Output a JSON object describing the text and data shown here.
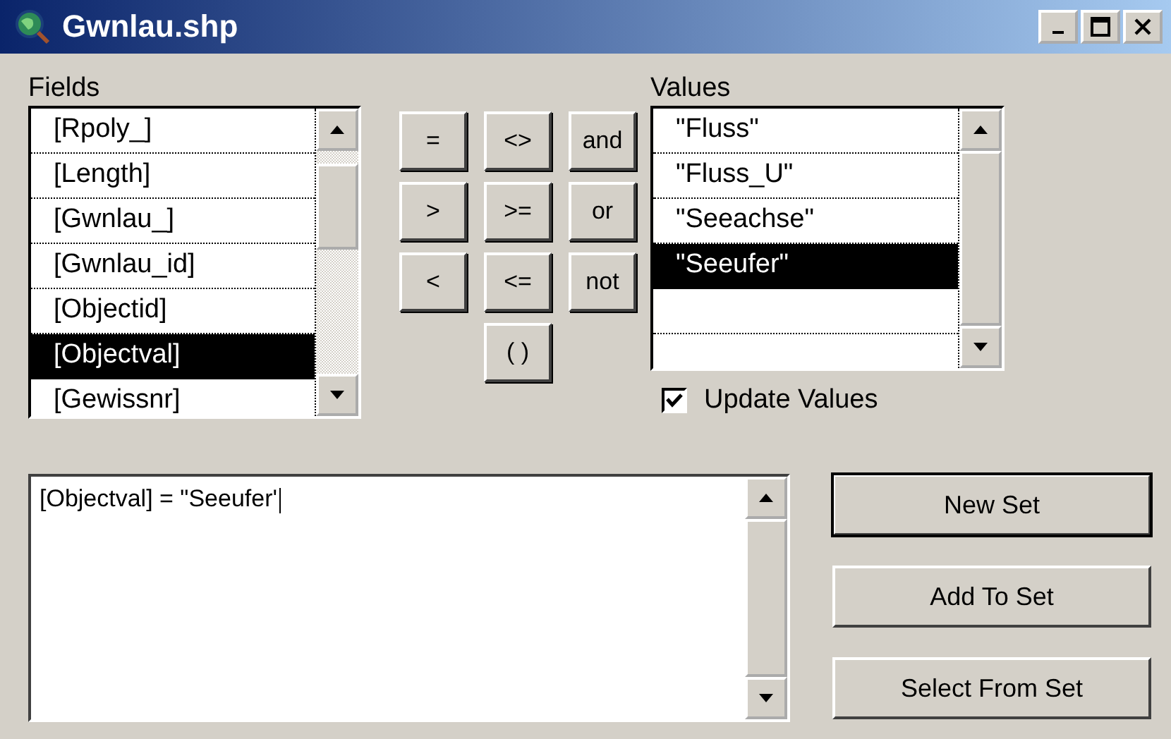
{
  "window": {
    "title": "Gwnlau.shp"
  },
  "fields": {
    "label": "Fields",
    "items": [
      {
        "name": "[Rpoly_]",
        "selected": false
      },
      {
        "name": "[Length]",
        "selected": false
      },
      {
        "name": "[Gwnlau_]",
        "selected": false
      },
      {
        "name": "[Gwnlau_id]",
        "selected": false
      },
      {
        "name": "[Objectid]",
        "selected": false
      },
      {
        "name": "[Objectval]",
        "selected": true
      },
      {
        "name": "[Gewissnr]",
        "selected": false
      }
    ]
  },
  "operators": [
    [
      "=",
      "<>",
      "and"
    ],
    [
      ">",
      ">=",
      "or"
    ],
    [
      "<",
      "<=",
      "not"
    ],
    [
      "( )"
    ]
  ],
  "values": {
    "label": "Values",
    "items": [
      {
        "name": "\"Fluss\"",
        "selected": false
      },
      {
        "name": "\"Fluss_U\"",
        "selected": false
      },
      {
        "name": "\"Seeachse\"",
        "selected": false
      },
      {
        "name": "\"Seeufer\"",
        "selected": true
      }
    ]
  },
  "update_values": {
    "label": "Update Values",
    "checked": true
  },
  "expression": {
    "value": "[Objectval] = \"Seeufer'"
  },
  "buttons": [
    {
      "label": "New Set",
      "default": true
    },
    {
      "label": "Add To Set",
      "default": false
    },
    {
      "label": "Select From Set",
      "default": false
    }
  ]
}
